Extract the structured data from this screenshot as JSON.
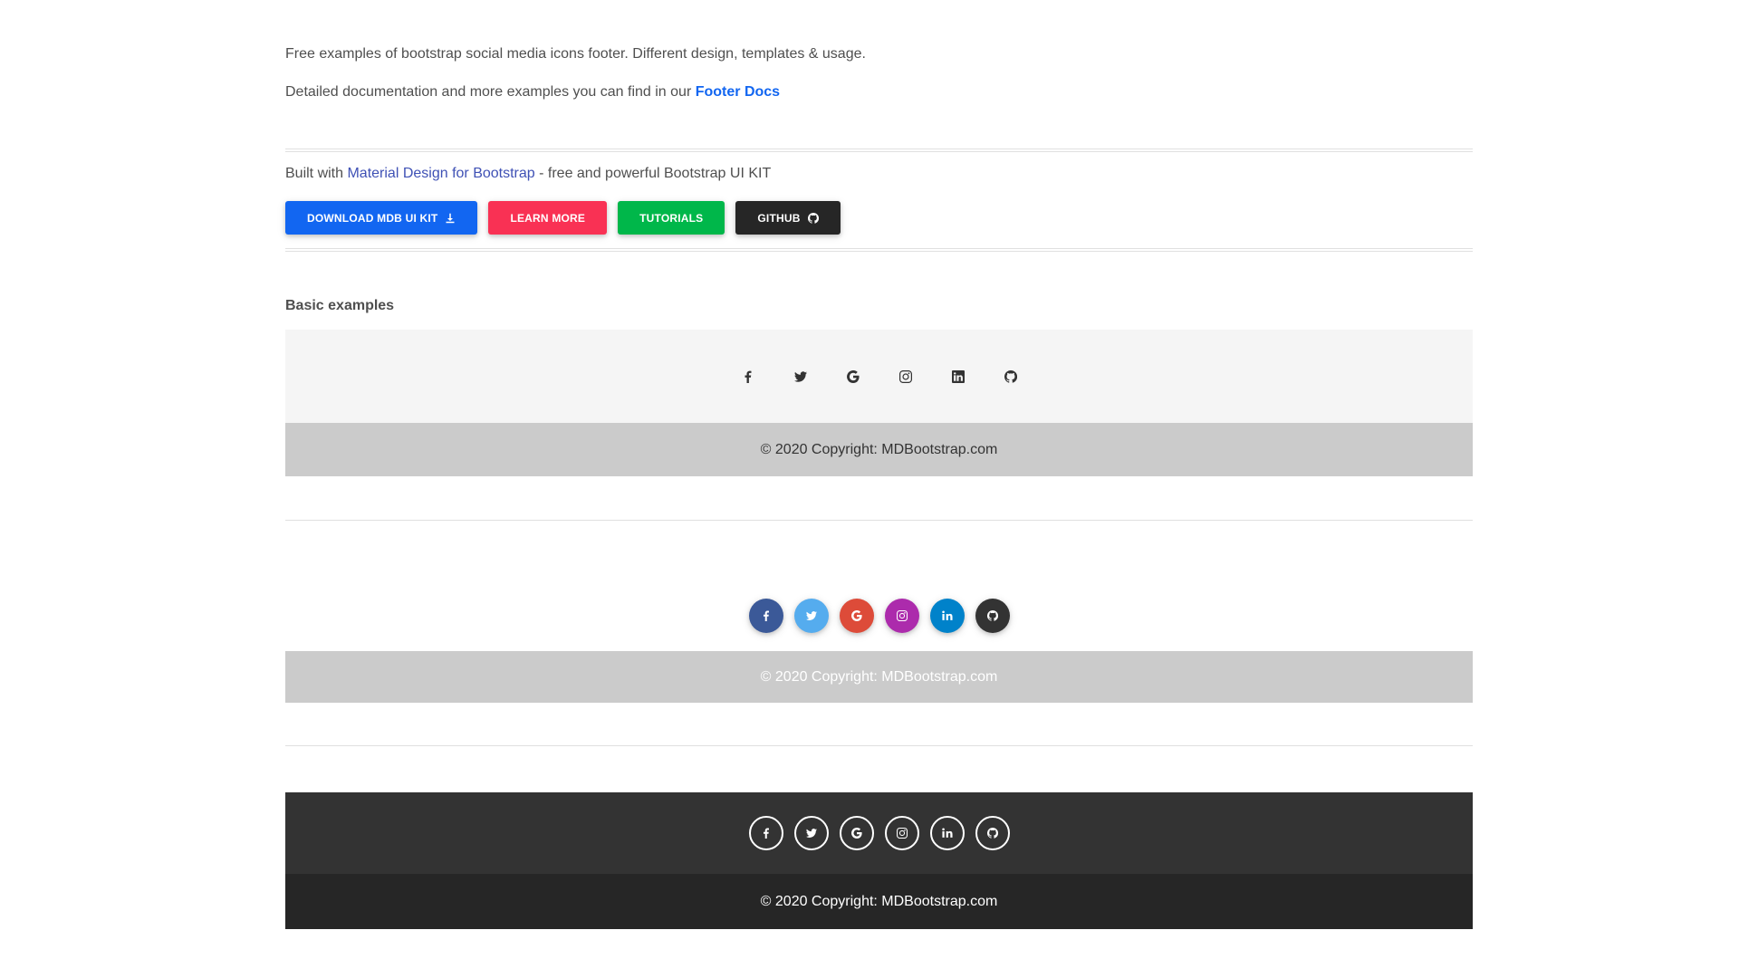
{
  "intro": {
    "line1": "Free examples of bootstrap social media icons footer. Different design, templates & usage.",
    "line2_prefix": "Detailed documentation and more examples you can find in our ",
    "line2_link": "Footer Docs"
  },
  "built": {
    "prefix": "Built with ",
    "link": "Material Design for Bootstrap",
    "suffix": " - free and powerful Bootstrap UI KIT"
  },
  "buttons": [
    {
      "label": "DOWNLOAD MDB UI KIT",
      "color": "#1266f1",
      "icon": "download-icon"
    },
    {
      "label": "LEARN MORE",
      "color": "#f93154",
      "icon": null
    },
    {
      "label": "TUTORIALS",
      "color": "#00b74a",
      "icon": null
    },
    {
      "label": "GITHUB",
      "color": "#262626",
      "icon": "github-icon"
    }
  ],
  "section_title": "Basic examples",
  "social_icons": [
    "facebook-icon",
    "twitter-icon",
    "google-icon",
    "instagram-icon",
    "linkedin-icon",
    "github-icon"
  ],
  "brand_colors": {
    "facebook": "#3b5998",
    "twitter": "#55acee",
    "google": "#dd4b39",
    "instagram": "#ac2bac",
    "linkedin": "#0082ca",
    "github": "#333333"
  },
  "footers": [
    {
      "copyright": "© 2020 Copyright: MDBootstrap.com",
      "background": "#f5f5f5",
      "copyright_background": "#cbcbcb"
    },
    {
      "copyright": "© 2020 Copyright: MDBootstrap.com",
      "background": "#ffffff",
      "copyright_background": "#cbcbcb"
    },
    {
      "copyright": "© 2020 Copyright: MDBootstrap.com",
      "background": "#333333",
      "copyright_background": "#262626"
    }
  ]
}
